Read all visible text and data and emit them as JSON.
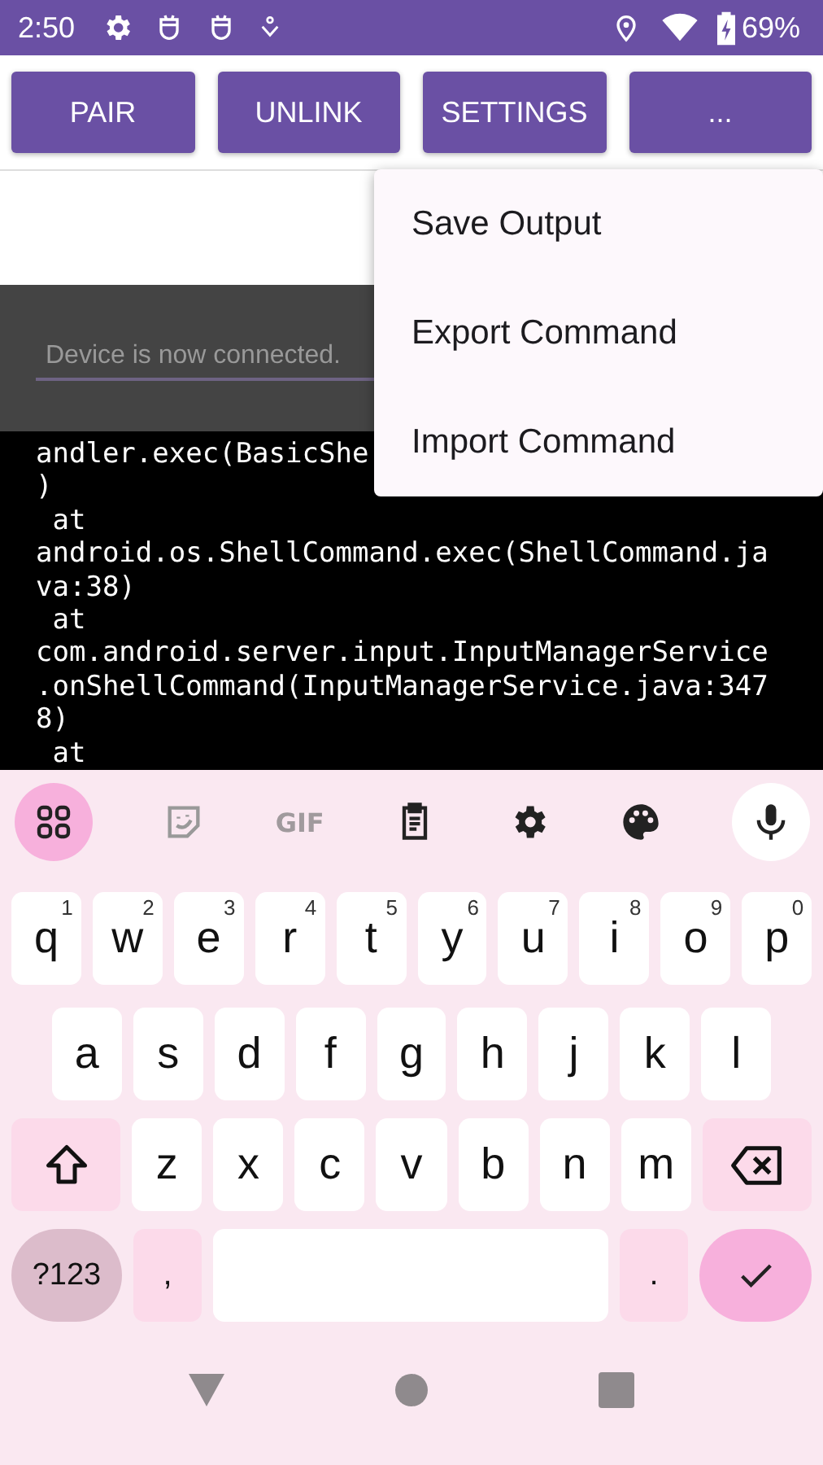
{
  "status_bar": {
    "time": "2:50",
    "battery": "69%"
  },
  "buttons": [
    {
      "label": "PAIR"
    },
    {
      "label": "UNLINK"
    },
    {
      "label": "SETTINGS"
    },
    {
      "label": "..."
    }
  ],
  "status_field": {
    "value": "Device is now connected."
  },
  "terminal": {
    "lines": [
      "andler.exec(BasicShe",
      ")",
      " at",
      "android.os.ShellCommand.exec(ShellCommand.ja",
      "va:38)",
      " at",
      "com.android.server.input.InputManagerService",
      ".onShellCommand(InputManagerService.java:347",
      "8)",
      " at"
    ]
  },
  "menu": {
    "items": [
      {
        "label": "Save Output"
      },
      {
        "label": "Export Command"
      },
      {
        "label": "Import Command"
      }
    ]
  },
  "keyboard": {
    "toolbar_text": "GIF",
    "key_rows": [
      {
        "keys": [
          {
            "kind": "letter",
            "label": "q",
            "hint": "1"
          },
          {
            "kind": "letter",
            "label": "w",
            "hint": "2"
          },
          {
            "kind": "letter",
            "label": "e",
            "hint": "3"
          },
          {
            "kind": "letter",
            "label": "r",
            "hint": "4"
          },
          {
            "kind": "letter",
            "label": "t",
            "hint": "5"
          },
          {
            "kind": "letter",
            "label": "y",
            "hint": "6"
          },
          {
            "kind": "letter",
            "label": "u",
            "hint": "7"
          },
          {
            "kind": "letter",
            "label": "i",
            "hint": "8"
          },
          {
            "kind": "letter",
            "label": "o",
            "hint": "9"
          },
          {
            "kind": "letter",
            "label": "p",
            "hint": "0"
          }
        ]
      },
      {
        "keys": [
          {
            "kind": "letter",
            "label": "a"
          },
          {
            "kind": "letter",
            "label": "s"
          },
          {
            "kind": "letter",
            "label": "d"
          },
          {
            "kind": "letter",
            "label": "f"
          },
          {
            "kind": "letter",
            "label": "g"
          },
          {
            "kind": "letter",
            "label": "h"
          },
          {
            "kind": "letter",
            "label": "j"
          },
          {
            "kind": "letter",
            "label": "k"
          },
          {
            "kind": "letter",
            "label": "l"
          }
        ]
      },
      {
        "keys": [
          {
            "kind": "shift"
          },
          {
            "kind": "letter",
            "label": "z"
          },
          {
            "kind": "letter",
            "label": "x"
          },
          {
            "kind": "letter",
            "label": "c"
          },
          {
            "kind": "letter",
            "label": "v"
          },
          {
            "kind": "letter",
            "label": "b"
          },
          {
            "kind": "letter",
            "label": "n"
          },
          {
            "kind": "letter",
            "label": "m"
          },
          {
            "kind": "backspace"
          }
        ]
      },
      {
        "keys": [
          {
            "kind": "symbols",
            "label": "?123"
          },
          {
            "kind": "punct",
            "label": ","
          },
          {
            "kind": "space"
          },
          {
            "kind": "punct",
            "label": "."
          },
          {
            "kind": "enter"
          }
        ]
      }
    ]
  }
}
